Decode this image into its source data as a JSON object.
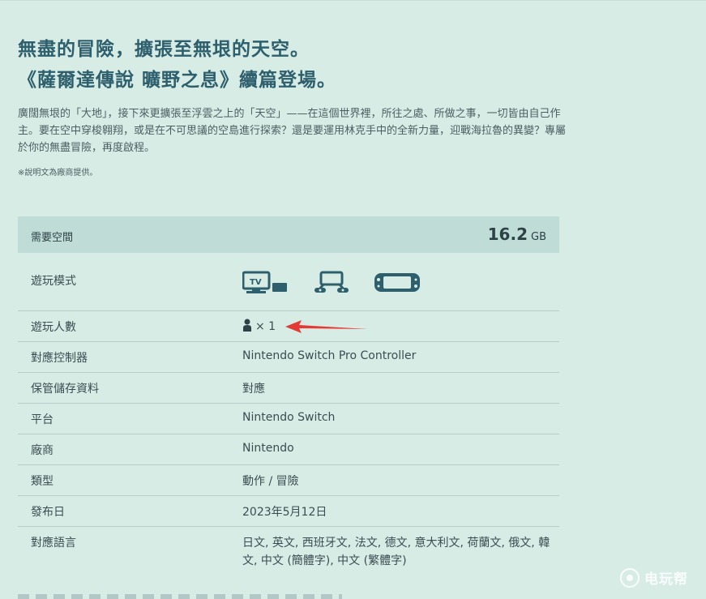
{
  "headline": {
    "line1": "無盡的冒險，擴張至無垠的天空。",
    "line2": "《薩爾達傳說 曠野之息》續篇登場。"
  },
  "description": "廣闊無垠的「大地」，接下來更擴張至浮雲之上的「天空」——在這個世界裡，所往之處、所做之事，一切皆由自己作主。要在空中穿梭翱翔，或是在不可思議的空島進行探索？還是要運用林克手中的全新力量，迎戰海拉魯的異變？專屬於你的無盡冒險，再度啟程。",
  "note": "※說明文為廠商提供。",
  "specs": {
    "space": {
      "label": "需要空間",
      "value": "16.2",
      "unit": "GB"
    },
    "play_modes": {
      "label": "遊玩模式",
      "icons": [
        "tv-mode-icon",
        "tabletop-mode-icon",
        "handheld-mode-icon"
      ]
    },
    "players": {
      "label": "遊玩人數",
      "value": "× 1",
      "icon": "person-icon"
    },
    "controllers": {
      "label": "對應控制器",
      "value": "Nintendo Switch Pro Controller"
    },
    "save_data": {
      "label": "保管儲存資料",
      "value": "對應"
    },
    "platform": {
      "label": "平台",
      "value": "Nintendo Switch"
    },
    "publisher": {
      "label": "廠商",
      "value": "Nintendo"
    },
    "genre": {
      "label": "類型",
      "value": "動作 / 冒險"
    },
    "release": {
      "label": "發布日",
      "value": "2023年5月12日"
    },
    "languages": {
      "label": "對應語言",
      "value": "日文, 英文, 西班牙文, 法文, 德文, 意大利文, 荷蘭文, 俄文, 韓文, 中文 (簡體字), 中文 (繁體字)"
    }
  },
  "watermark": {
    "text": "电玩帮"
  },
  "colors": {
    "background": "#d8ece6",
    "header_band": "#bfdcd7",
    "accent": "#2e5f6c",
    "arrow": "#e53935"
  }
}
